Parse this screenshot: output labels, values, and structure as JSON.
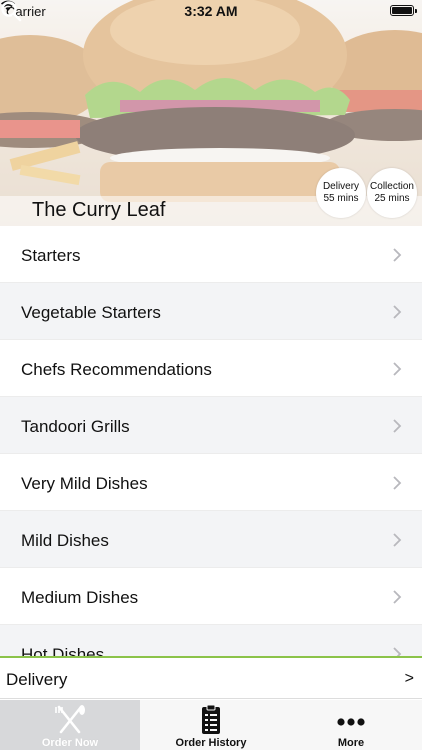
{
  "status_bar": {
    "carrier": "Carrier",
    "time": "3:32 AM"
  },
  "header": {
    "restaurant_name": "The Curry Leaf",
    "delivery_badge": {
      "title": "Delivery",
      "time": "55 mins"
    },
    "collection_badge": {
      "title": "Collection",
      "time": "25 mins"
    }
  },
  "menu": {
    "items": [
      {
        "label": "Starters"
      },
      {
        "label": "Vegetable Starters"
      },
      {
        "label": "Chefs Recommendations"
      },
      {
        "label": "Tandoori Grills"
      },
      {
        "label": "Very Mild Dishes"
      },
      {
        "label": "Mild Dishes"
      },
      {
        "label": "Medium Dishes"
      },
      {
        "label": "Hot Dishes"
      }
    ]
  },
  "delivery_bar": {
    "label": "Delivery",
    "arrow": ">"
  },
  "tab_bar": {
    "tabs": [
      {
        "label": "Order Now",
        "icon": "fork-knife-icon"
      },
      {
        "label": "Order History",
        "icon": "receipt-icon"
      },
      {
        "label": "More",
        "icon": "more-dots-icon"
      }
    ]
  },
  "colors": {
    "accent_green": "#8bc34a",
    "alt_row": "#f3f4f6",
    "tab_active": "#d7d8da"
  }
}
